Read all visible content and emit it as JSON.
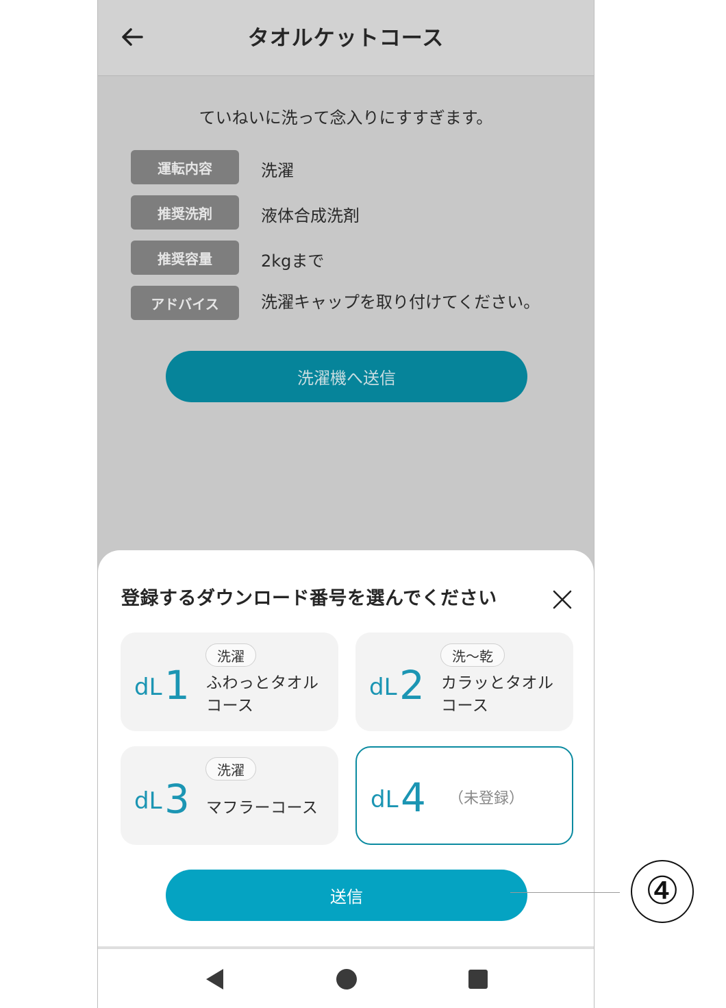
{
  "header": {
    "title": "タオルケットコース",
    "back_icon": "arrow-left-icon"
  },
  "course": {
    "description": "ていねいに洗って念入りにすすぎます。",
    "rows": [
      {
        "tag": "運転内容",
        "value": "洗濯"
      },
      {
        "tag": "推奨洗剤",
        "value": "液体合成洗剤"
      },
      {
        "tag": "推奨容量",
        "value": "2kgまで"
      },
      {
        "tag": "アドバイス",
        "value": "洗濯キャップを取り付けてください。"
      }
    ],
    "send_to_machine_label": "洗濯機へ送信"
  },
  "sheet": {
    "title": "登録するダウンロード番号を選んでください",
    "close_icon": "close-icon",
    "slots": [
      {
        "prefix": "dL",
        "number": "1",
        "badge": "洗濯",
        "name": "ふわっとタオル\nコース"
      },
      {
        "prefix": "dL",
        "number": "2",
        "badge": "洗～乾",
        "name": "カラッとタオル\nコース"
      },
      {
        "prefix": "dL",
        "number": "3",
        "badge": "洗濯",
        "name": "マフラーコース"
      },
      {
        "prefix": "dL",
        "number": "4",
        "unregistered": "（未登録）",
        "selected": true
      }
    ],
    "send_label": "送信"
  },
  "callout": {
    "marker": "④"
  },
  "colors": {
    "accent": "#05a3c2",
    "accent_dark": "#06849a",
    "dl_text": "#1b95b3"
  }
}
